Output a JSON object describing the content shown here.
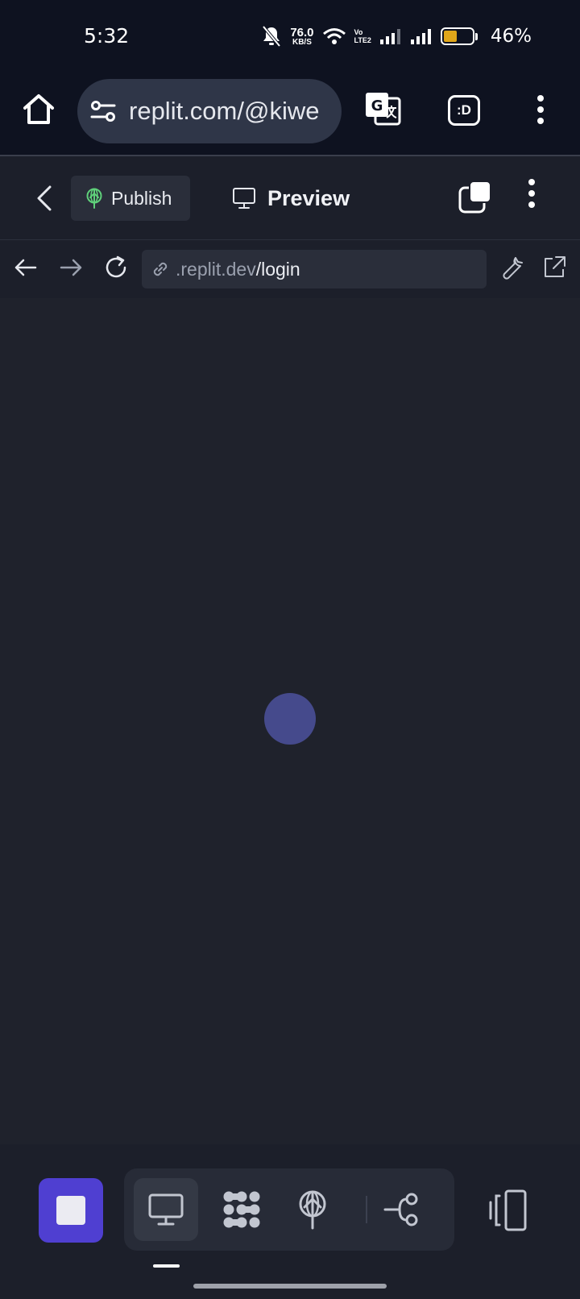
{
  "status_bar": {
    "time": "5:32",
    "net_speed_value": "76.0",
    "net_speed_unit": "KB/S",
    "volte_line1": "Vo",
    "volte_line2": "LTE2",
    "battery_percent": "46%",
    "battery_level": 0.46,
    "battery_color": "#e0a61a",
    "icons": [
      "bell-muted-icon",
      "wifi-icon",
      "signal-icon",
      "signal-icon"
    ]
  },
  "browser": {
    "url": "replit.com/@kiwe",
    "extension_label": ":D",
    "icons": [
      "home-icon",
      "tune-icon",
      "translate-icon",
      "more-vert-icon"
    ]
  },
  "replit_header": {
    "publish_label": "Publish",
    "preview_label": "Preview",
    "publish_icon_color": "#5fd07a",
    "icons": [
      "chevron-left-icon",
      "publish-icon",
      "monitor-icon",
      "tabs-icon",
      "more-vert-icon"
    ]
  },
  "webview_nav": {
    "host": ".replit.dev",
    "path": "/login",
    "icons": [
      "arrow-left-icon",
      "arrow-right-icon",
      "reload-icon",
      "link-icon",
      "wrench-icon",
      "external-link-icon"
    ]
  },
  "content": {
    "loading_indicator_color": "#454a8c"
  },
  "bottom_bar": {
    "stop_button_color": "#4f3fd1",
    "tools": [
      "monitor-icon",
      "agent-icon",
      "publish-icon",
      "git-branch-icon"
    ],
    "active_tool": "monitor-icon",
    "panel_icon": "panel-toggle-icon"
  }
}
